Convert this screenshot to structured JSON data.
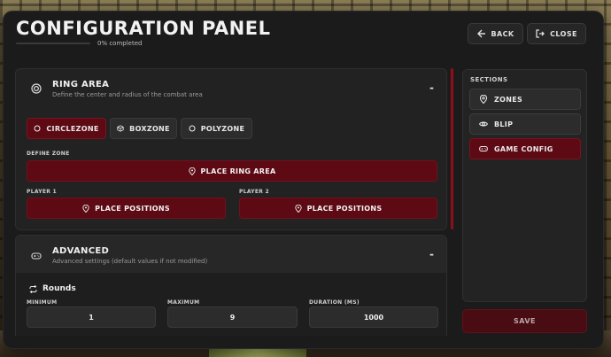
{
  "header": {
    "title": "CONFIGURATION PANEL",
    "progress_label": "0% completed",
    "progress_fraction": 0,
    "back_label": "BACK",
    "close_label": "CLOSE"
  },
  "ring_area": {
    "title": "RING AREA",
    "subtitle": "Define the center and radius of the combat area",
    "toggle": "-",
    "zone_tabs": [
      {
        "label": "CIRCLEZONE",
        "active": true
      },
      {
        "label": "BOXZONE",
        "active": false
      },
      {
        "label": "POLYZONE",
        "active": false
      }
    ],
    "define_zone_label": "DEFINE ZONE",
    "place_ring_label": "PLACE RING AREA",
    "player1_label": "PLAYER 1",
    "player2_label": "PLAYER 2",
    "place_positions_label": "PLACE POSITIONS"
  },
  "advanced": {
    "title": "ADVANCED",
    "subtitle": "Advanced settings (default values if not modified)",
    "toggle": "-",
    "rounds_label": "Rounds",
    "fields": [
      {
        "label": "MINIMUM",
        "value": "1"
      },
      {
        "label": "MAXIMUM",
        "value": "9"
      },
      {
        "label": "DURATION (MS)",
        "value": "1000"
      }
    ]
  },
  "sidebar": {
    "title": "SECTIONS",
    "items": [
      {
        "label": "ZONES",
        "icon": "map-pin-icon",
        "active": false
      },
      {
        "label": "BLIP",
        "icon": "eye-icon",
        "active": false
      },
      {
        "label": "GAME CONFIG",
        "icon": "gamepad-icon",
        "active": true
      }
    ],
    "save_label": "SAVE"
  },
  "colors": {
    "accent": "#5d0a14",
    "accent_bright": "#8e0f1b",
    "panel": "#1b1b1b",
    "card": "#222222"
  }
}
